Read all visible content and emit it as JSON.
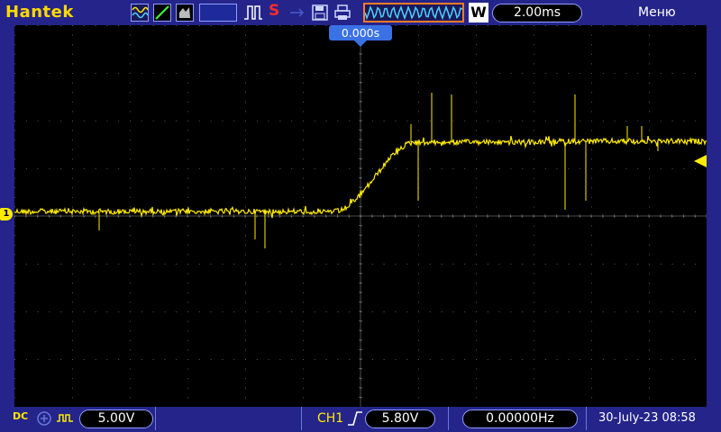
{
  "app": {
    "brand": "Hantek"
  },
  "toolbar": {
    "stop_label": "S",
    "timebase": "2.00ms",
    "w_label": "W",
    "menu_label": "Меню"
  },
  "screen": {
    "trigger_position": "0.000s",
    "ch1_marker": "1",
    "trace_color": "#ffeb00"
  },
  "status": {
    "coupling": "DC",
    "ch1_volts_div": "5.00V",
    "trigger_source": "CH1",
    "trigger_level": "5.80V",
    "frequency": "0.00000Hz",
    "datetime": "30-July-23 08:58"
  },
  "icons": [
    "wave-mode-icon",
    "ramp-icon",
    "persistence-icon",
    "pulse-icon",
    "stop-icon",
    "usb-icon",
    "save-icon",
    "print-icon",
    "rising-edge-icon",
    "bandwidth-limit-icon",
    "probe-icon"
  ],
  "colors": {
    "background": "#24248a",
    "brand": "#ffd800",
    "trace": "#ffeb00",
    "accent": "#3a72e6",
    "highlight": "#ff7b2c"
  }
}
